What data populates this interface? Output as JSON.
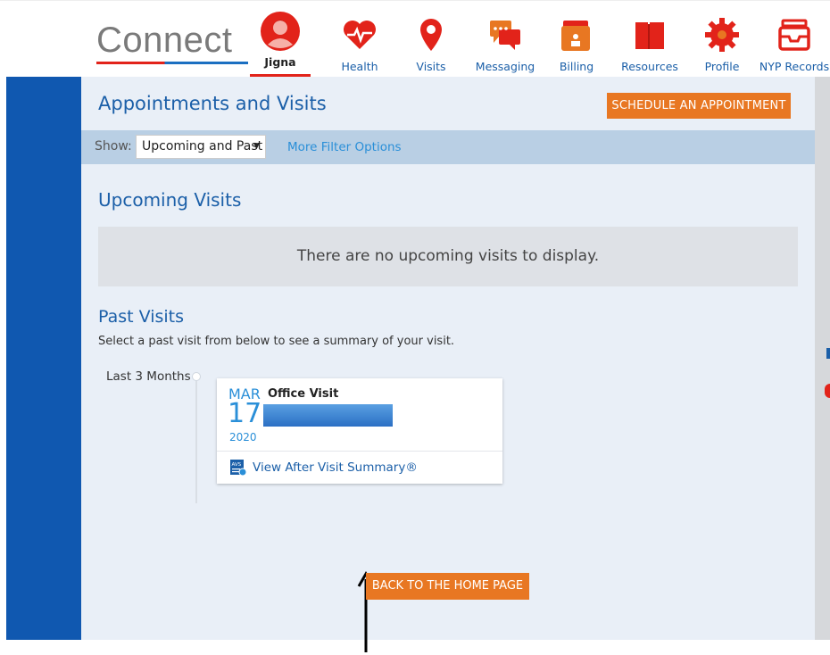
{
  "app": {
    "logo_text": "Connect"
  },
  "nav": {
    "user_label": "Jigna",
    "items": [
      {
        "label": "Health",
        "icon": "heart-icon"
      },
      {
        "label": "Visits",
        "icon": "location-pin-icon",
        "active": true
      },
      {
        "label": "Messaging",
        "icon": "chat-icon"
      },
      {
        "label": "Billing",
        "icon": "wallet-icon"
      },
      {
        "label": "Resources",
        "icon": "book-icon"
      },
      {
        "label": "Profile",
        "icon": "gear-icon"
      },
      {
        "label": "NYP Records",
        "icon": "inbox-tray-icon"
      }
    ]
  },
  "page": {
    "title": "Appointments and Visits",
    "schedule_button": "SCHEDULE AN APPOINTMENT",
    "filter": {
      "show_label": "Show:",
      "selected": "Upcoming and Past",
      "more_link": "More Filter Options"
    },
    "upcoming": {
      "heading": "Upcoming Visits",
      "empty_message": "There are no upcoming visits to display."
    },
    "past": {
      "heading": "Past Visits",
      "subtext": "Select a past visit from below to see a summary of your visit.",
      "range_label": "Last 3 Months",
      "visits": [
        {
          "month": "MAR",
          "day": "17",
          "year": "2020",
          "type": "Office Visit",
          "summary_link": "View After Visit Summary®"
        }
      ]
    },
    "back_button": "BACK TO THE HOME PAGE"
  },
  "colors": {
    "brand_blue": "#1058b0",
    "accent_orange": "#e87722",
    "nav_red": "#e2231a",
    "panel_bg": "#e9eff7"
  }
}
